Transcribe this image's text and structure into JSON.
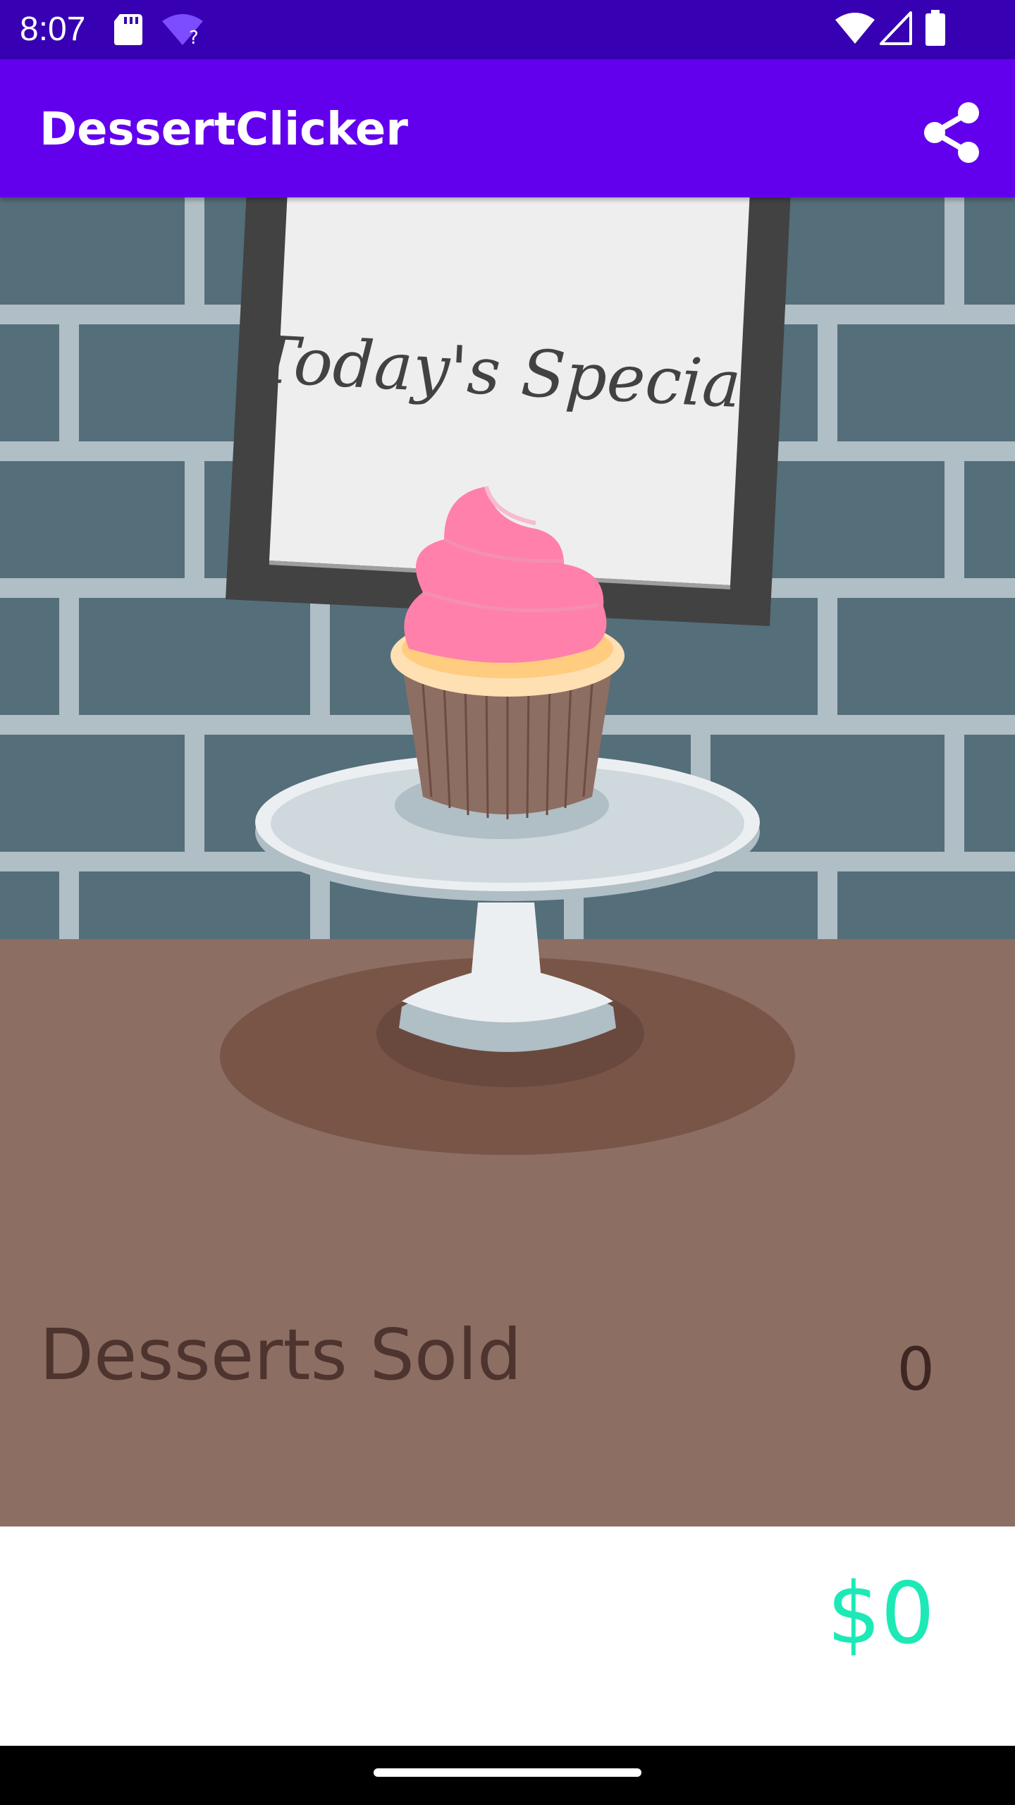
{
  "status_bar": {
    "time": "8:07",
    "icons": [
      "sd-card-icon",
      "wifi-question-icon",
      "wifi-signal-icon",
      "cell-signal-icon",
      "battery-icon"
    ]
  },
  "app_bar": {
    "title": "DessertClicker",
    "share_icon": "share-icon"
  },
  "dessert_scene": {
    "sign_text": "Today's Special",
    "dessert_icon": "cupcake-icon"
  },
  "stats": {
    "desserts_sold_label": "Desserts Sold",
    "desserts_sold_value": "0",
    "revenue": "$0"
  },
  "colors": {
    "status_bar": "#3700B3",
    "app_bar": "#6200EE",
    "brick_wall": "#546E7A",
    "mortar": "#B0BEC5",
    "table": "#8D6E63",
    "revenue_text": "#1DE9B6",
    "frosting": "#FF80AB"
  }
}
